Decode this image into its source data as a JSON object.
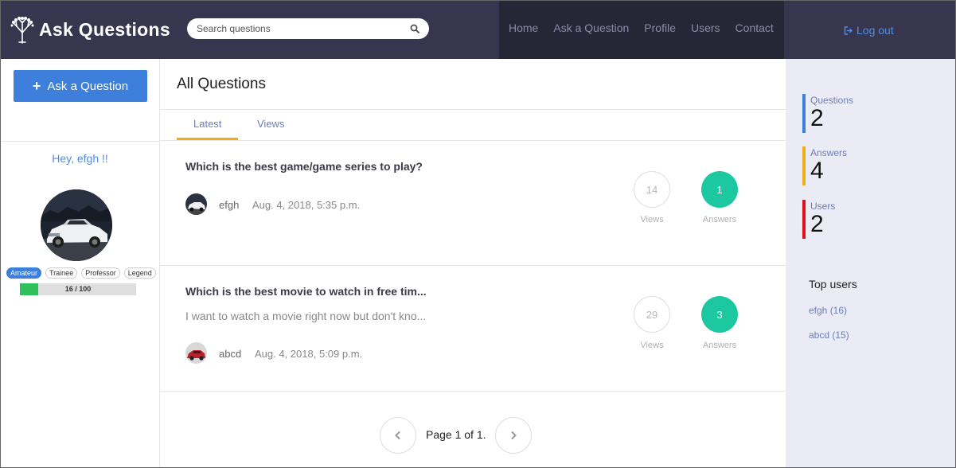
{
  "header": {
    "logo_text": "Ask Questions",
    "search_placeholder": "Search questions",
    "nav": [
      "Home",
      "Ask a Question",
      "Profile",
      "Users",
      "Contact"
    ],
    "logout_label": "Log out"
  },
  "left": {
    "ask_button_label": "Ask a Question",
    "greeting": "Hey, efgh !!",
    "ranks": [
      {
        "label": "Amateur",
        "active": true
      },
      {
        "label": "Trainee",
        "active": false
      },
      {
        "label": "Professor",
        "active": false
      },
      {
        "label": "Legend",
        "active": false
      }
    ],
    "progress": {
      "text": "16 / 100",
      "fraction": 0.16
    }
  },
  "main": {
    "title": "All Questions",
    "tabs": [
      {
        "label": "Latest",
        "active": true
      },
      {
        "label": "Views",
        "active": false
      }
    ],
    "questions": [
      {
        "title": "Which is the best game/game series to play?",
        "excerpt": "",
        "author": "efgh",
        "date": "Aug. 4, 2018, 5:35 p.m.",
        "views": "14",
        "answers": "1",
        "views_label": "Views",
        "answers_label": "Answers"
      },
      {
        "title": "Which is the best movie to watch in free tim...",
        "excerpt": "I want to watch a movie right now but don't kno...",
        "author": "abcd",
        "date": "Aug. 4, 2018, 5:09 p.m.",
        "views": "29",
        "answers": "3",
        "views_label": "Views",
        "answers_label": "Answers"
      }
    ],
    "pagination": "Page 1 of 1."
  },
  "right": {
    "stats": [
      {
        "label": "Questions",
        "value": "2",
        "color": "#3d7fdb"
      },
      {
        "label": "Answers",
        "value": "4",
        "color": "#f0ad1a"
      },
      {
        "label": "Users",
        "value": "2",
        "color": "#e3101c"
      }
    ],
    "top_users_title": "Top users",
    "top_users": [
      "efgh (16)",
      "abcd (15)"
    ]
  },
  "colors": {
    "header_bg": "#38364f",
    "nav_bg": "#272637",
    "accent_blue": "#3d7fdb",
    "answers_green": "#1cc8a0",
    "tab_underline": "#f0ad1a",
    "sidebar_bg": "#ebebf6"
  }
}
